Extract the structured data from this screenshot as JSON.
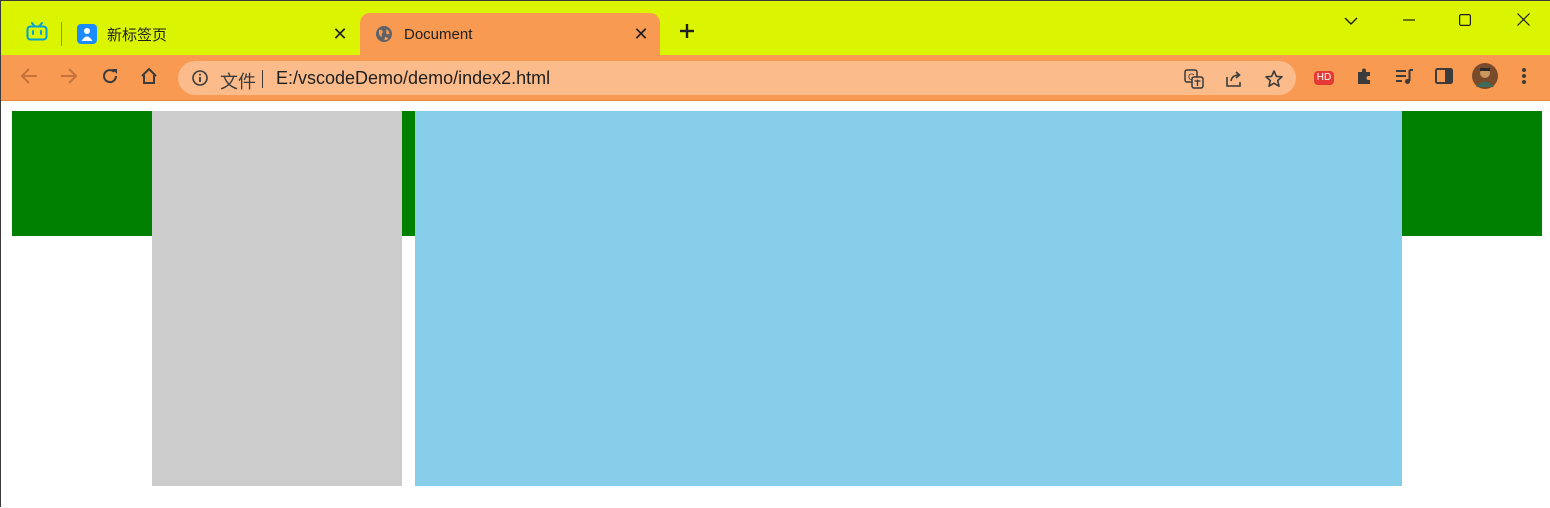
{
  "browser": {
    "tabs": [
      {
        "title": "新标签页",
        "icon": "bilibili-person-icon"
      },
      {
        "title": "Document",
        "icon": "globe-icon",
        "active": true
      }
    ],
    "pinned_tab_icon": "bilibili-tv-icon",
    "new_tab_icon": "plus-icon",
    "close_glyph": "✕",
    "window_controls": [
      "minimize",
      "maximize",
      "close"
    ],
    "tab_strip_color": "#dbf500",
    "toolbar_color": "#f89a52"
  },
  "omnibox": {
    "scheme_label": "文件",
    "url": "E:/vscodeDemo/demo/index2.html"
  },
  "extensions": {
    "hd_badge": "HD"
  },
  "page": {
    "background": "#ffffff",
    "blocks": [
      {
        "name": "green-bar",
        "color": "#008000"
      },
      {
        "name": "gray-box",
        "color": "#cccccc"
      },
      {
        "name": "blue-box",
        "color": "#87ceeb"
      }
    ]
  }
}
